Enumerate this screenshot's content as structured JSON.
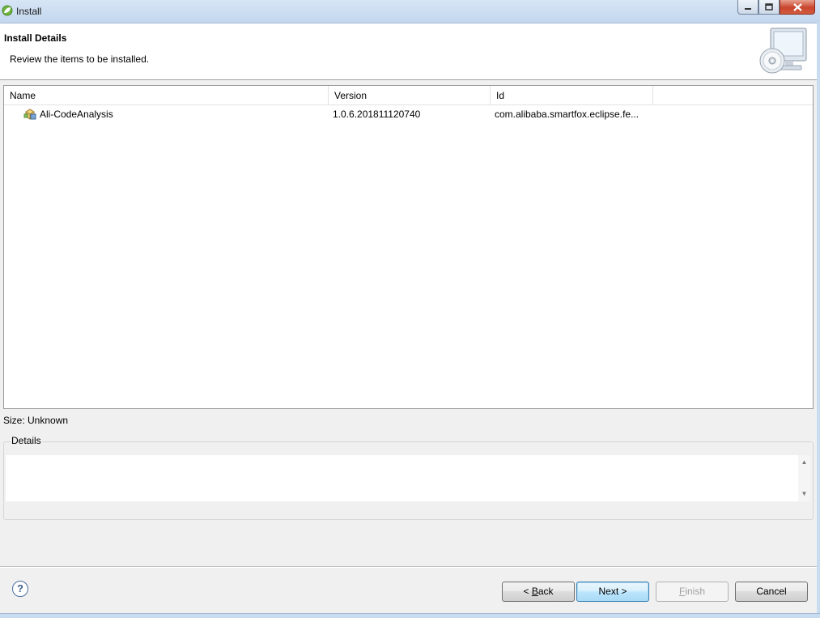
{
  "window": {
    "title": "Install",
    "controls": [
      "minimize",
      "maximize",
      "close"
    ]
  },
  "banner": {
    "title": "Install Details",
    "description": "Review the items to be installed.",
    "icon": "install-cd-computer-icon"
  },
  "table": {
    "columns": [
      "Name",
      "Version",
      "Id"
    ],
    "rows": [
      {
        "name": "Ali-CodeAnalysis",
        "version": "1.0.6.201811120740",
        "id": "com.alibaba.smartfox.eclipse.fe...",
        "icon": "feature-icon"
      }
    ]
  },
  "size": {
    "label": "Size: Unknown"
  },
  "details": {
    "label": "Details",
    "text": ""
  },
  "footer": {
    "help_icon": "?",
    "buttons": {
      "back": {
        "prefix": "< ",
        "mnemonic": "B",
        "rest": "ack"
      },
      "next": "Next >",
      "finish": {
        "mnemonic": "F",
        "rest": "inish"
      },
      "cancel": "Cancel"
    }
  },
  "colors": {
    "titlebar": "#c3d7ee",
    "default_button_border": "#3c7fb1",
    "close_button": "#c9452d"
  }
}
